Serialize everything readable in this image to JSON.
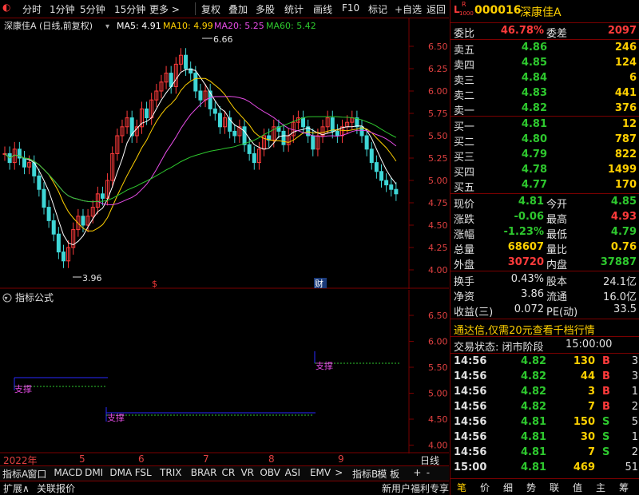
{
  "toolbar": {
    "items": [
      "分时",
      "1分钟",
      "5分钟",
      "15分钟",
      "更多 >",
      "复权",
      "叠加",
      "多股",
      "统计",
      "画线",
      "F10",
      "标记",
      "+自选",
      "返回"
    ]
  },
  "chart": {
    "title": "深康佳A (日线,前复权)",
    "ma5": "MA5: 4.91",
    "ma10": "MA10: 4.99",
    "ma20": "MA20: 5.25",
    "ma60": "MA60: 5.42",
    "high_label": "6.66",
    "low_label": "3.96",
    "price_ticks": [
      "6.50",
      "6.25",
      "6.00",
      "5.75",
      "5.50",
      "5.25",
      "5.00",
      "4.75",
      "4.50",
      "4.25",
      "4.00"
    ],
    "event_marks": [
      "$",
      "财"
    ],
    "colors": {
      "ma5": "#ffffff",
      "ma10": "#ffd000",
      "ma20": "#e64ce6",
      "ma60": "#2ec82e",
      "up": "#ff3b3b",
      "down": "#3fd6d6"
    }
  },
  "indicator": {
    "title": "指标公式",
    "ticks": [
      "6.50",
      "6.00",
      "5.50",
      "5.00",
      "4.50",
      "4.00"
    ],
    "support_label": "支撑"
  },
  "date_axis": {
    "labels": [
      "2022年",
      "5",
      "6",
      "7",
      "8",
      "9"
    ],
    "right": "日线"
  },
  "bottom_tabs": [
    "指标A",
    "窗口",
    "MACD",
    "DMI",
    "DMA",
    "FSL",
    "TRIX",
    "BRAR",
    "CR",
    "VR",
    "OBV",
    "ASI",
    "EMV",
    ">",
    "指标B",
    "模 板",
    "+",
    "-"
  ],
  "bottom_row2": [
    "扩展∧",
    "关联报价"
  ],
  "stock": {
    "code": "000016",
    "name": "深康佳A",
    "badge_l": "L",
    "badge_r": "R",
    "badge_num": "1000"
  },
  "order_book": {
    "webi_label": "委比",
    "webi": "46.78%",
    "wecha_label": "委差",
    "wecha": "2097",
    "asks": [
      {
        "label": "卖五",
        "price": "4.86",
        "vol": "246"
      },
      {
        "label": "卖四",
        "price": "4.85",
        "vol": "124"
      },
      {
        "label": "卖三",
        "price": "4.84",
        "vol": "6"
      },
      {
        "label": "卖二",
        "price": "4.83",
        "vol": "441"
      },
      {
        "label": "卖一",
        "price": "4.82",
        "vol": "376"
      }
    ],
    "bids": [
      {
        "label": "买一",
        "price": "4.81",
        "vol": "12"
      },
      {
        "label": "买二",
        "price": "4.80",
        "vol": "787"
      },
      {
        "label": "买三",
        "price": "4.79",
        "vol": "822"
      },
      {
        "label": "买四",
        "price": "4.78",
        "vol": "1499"
      },
      {
        "label": "买五",
        "price": "4.77",
        "vol": "170"
      }
    ]
  },
  "quote": [
    {
      "l1": "现价",
      "v1": "4.81",
      "c1": "green",
      "l2": "今开",
      "v2": "4.85",
      "c2": "green"
    },
    {
      "l1": "涨跌",
      "v1": "-0.06",
      "c1": "green",
      "l2": "最高",
      "v2": "4.93",
      "c2": "red"
    },
    {
      "l1": "涨幅",
      "v1": "-1.23%",
      "c1": "green",
      "l2": "最低",
      "v2": "4.79",
      "c2": "green"
    },
    {
      "l1": "总量",
      "v1": "68607",
      "c1": "yellow",
      "l2": "量比",
      "v2": "0.76",
      "c2": "yellow"
    },
    {
      "l1": "外盘",
      "v1": "30720",
      "c1": "red",
      "l2": "内盘",
      "v2": "37887",
      "c2": "green"
    }
  ],
  "fundamentals": [
    {
      "l1": "换手",
      "v1": "0.43%",
      "l2": "股本",
      "v2": "24.1亿"
    },
    {
      "l1": "净资",
      "v1": "3.86",
      "l2": "流通",
      "v2": "16.0亿"
    },
    {
      "l1": "收益(三)",
      "v1": "0.072",
      "l2": "PE(动)",
      "v2": "33.5"
    }
  ],
  "promo": "通达信,仅需20元查看千档行情",
  "trade_status": {
    "label": "交易状态: 闭市阶段",
    "time": "15:00:00"
  },
  "ticks": [
    {
      "time": "14:56",
      "price": "4.82",
      "vol": "130",
      "bs": "B",
      "n": "3"
    },
    {
      "time": "14:56",
      "price": "4.82",
      "vol": "44",
      "bs": "B",
      "n": "3"
    },
    {
      "time": "14:56",
      "price": "4.82",
      "vol": "3",
      "bs": "B",
      "n": "1"
    },
    {
      "time": "14:56",
      "price": "4.82",
      "vol": "7",
      "bs": "B",
      "n": "2"
    },
    {
      "time": "14:56",
      "price": "4.81",
      "vol": "150",
      "bs": "S",
      "n": "5"
    },
    {
      "time": "14:56",
      "price": "4.81",
      "vol": "30",
      "bs": "S",
      "n": "1"
    },
    {
      "time": "14:56",
      "price": "4.81",
      "vol": "7",
      "bs": "S",
      "n": "2"
    },
    {
      "time": "15:00",
      "price": "4.81",
      "vol": "469",
      "bs": "",
      "n": "51"
    }
  ],
  "promo_bottom": "新用户福利专享",
  "right_tabs": [
    "笔",
    "价",
    "细",
    "势",
    "联",
    "值",
    "主",
    "筹"
  ]
}
